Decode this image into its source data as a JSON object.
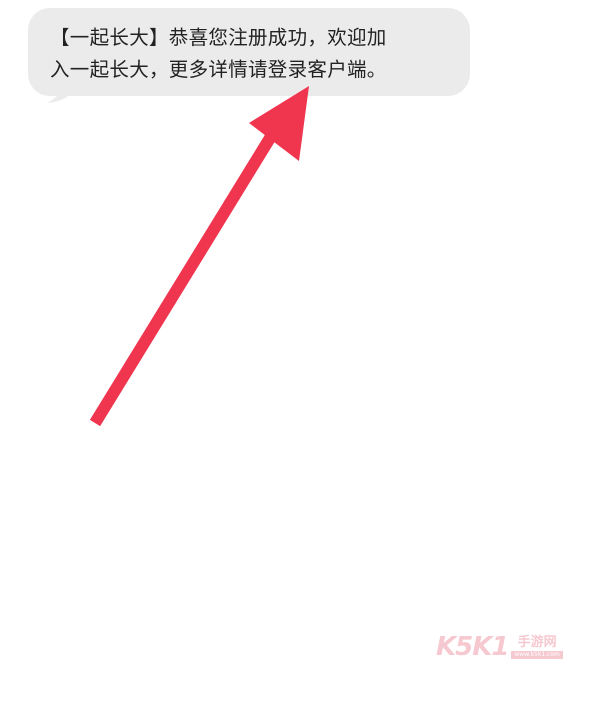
{
  "message": {
    "line1": "【一起长大】恭喜您注册成功，欢迎加",
    "line2": "入一起长大，更多详情请登录客户端。"
  },
  "annotation": {
    "icon": "arrow-up-right-icon",
    "color": "#f0354e"
  },
  "watermark": {
    "logo": "K5K1",
    "site_name": "手游网",
    "site_url": "www.k5k1.com"
  }
}
